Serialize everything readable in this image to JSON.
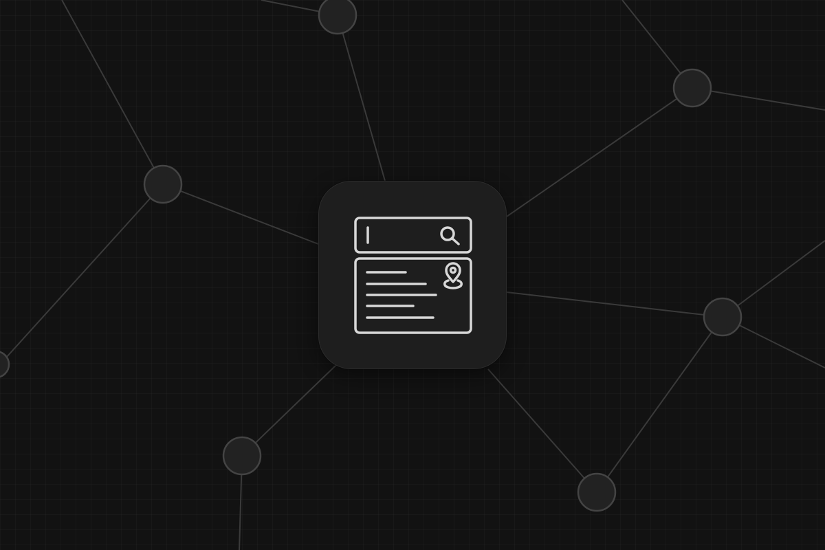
{
  "theme": {
    "background": "#121212",
    "tile": "#1e1e1e",
    "line": "#3a3a3a",
    "node_fill": "#222222",
    "node_stroke": "#444444",
    "glyph": "#d8d8d8"
  },
  "icons": {
    "app": "search-results-map-pin-icon",
    "search": "search-icon",
    "location": "map-pin-icon",
    "text_cursor": "text-cursor-icon"
  },
  "result_card": {
    "text_line_count": 5
  }
}
